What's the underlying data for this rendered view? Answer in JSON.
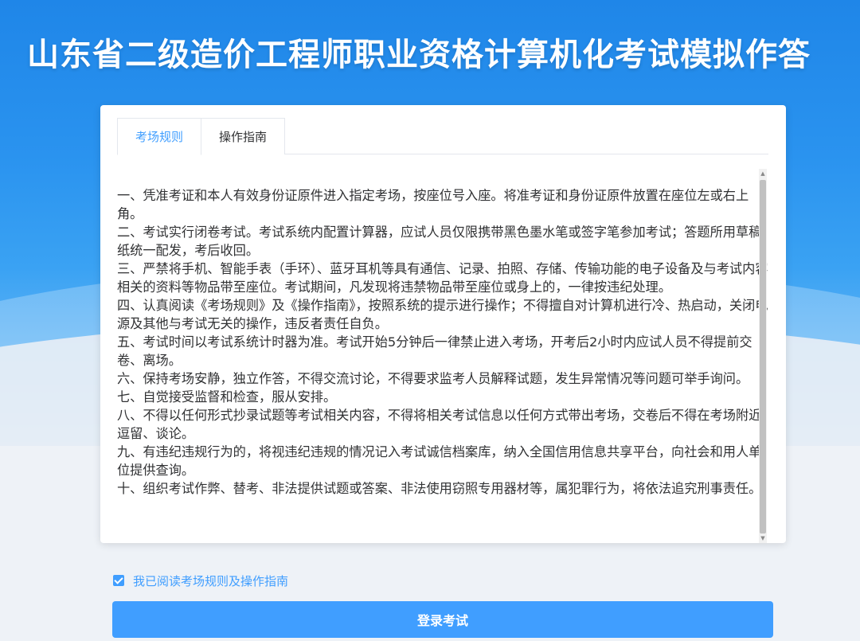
{
  "header": {
    "title": "山东省二级造价工程师职业资格计算机化考试模拟作答"
  },
  "tabs": [
    {
      "label": "考场规则",
      "active": true
    },
    {
      "label": "操作指南",
      "active": false
    }
  ],
  "rules": [
    "一、凭准考证和本人有效身份证原件进入指定考场，按座位号入座。将准考证和身份证原件放置在座位左或右上角。",
    "二、考试实行闭卷考试。考试系统内配置计算器，应试人员仅限携带黑色墨水笔或签字笔参加考试；答题所用草稿纸统一配发，考后收回。",
    "三、严禁将手机、智能手表（手环）、蓝牙耳机等具有通信、记录、拍照、存储、传输功能的电子设备及与考试内容相关的资料等物品带至座位。考试期间，凡发现将违禁物品带至座位或身上的，一律按违纪处理。",
    "四、认真阅读《考场规则》及《操作指南》，按照系统的提示进行操作；不得擅自对计算机进行冷、热启动，关闭电源及其他与考试无关的操作，违反者责任自负。",
    "五、考试时间以考试系统计时器为准。考试开始5分钟后一律禁止进入考场，开考后2小时内应试人员不得提前交卷、离场。",
    "六、保持考场安静，独立作答，不得交流讨论，不得要求监考人员解释试题，发生异常情况等问题可举手询问。",
    "七、自觉接受监督和检查，服从安排。",
    "八、不得以任何形式抄录试题等考试相关内容，不得将相关考试信息以任何方式带出考场，交卷后不得在考场附近逗留、谈论。",
    "九、有违纪违规行为的，将视违纪违规的情况记入考试诚信档案库，纳入全国信用信息共享平台，向社会和用人单位提供查询。",
    "十、组织考试作弊、替考、非法提供试题或答案、非法使用窃照专用器材等，属犯罪行为，将依法追究刑事责任。"
  ],
  "agree": {
    "label": "我已阅读考场规则及操作指南",
    "checked": true
  },
  "login_button": {
    "label": "登录考试"
  },
  "colors": {
    "accent": "#409eff",
    "header_bg": "#1f86e8"
  }
}
